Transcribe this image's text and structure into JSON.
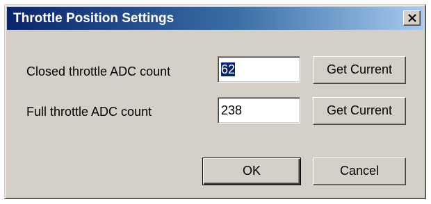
{
  "dialog": {
    "title": "Throttle Position Settings",
    "close_symbol": "close-icon"
  },
  "closed_row": {
    "label": "Closed throttle ADC count",
    "value": "62",
    "button_label": "Get Current"
  },
  "full_row": {
    "label": "Full throttle ADC count",
    "value": "238",
    "button_label": "Get Current"
  },
  "footer": {
    "ok_label": "OK",
    "cancel_label": "Cancel"
  },
  "colors": {
    "titlebar_start": "#0a246a",
    "titlebar_end": "#a6caf0",
    "window_face": "#d4d0c8",
    "selection": "#0a246a"
  }
}
